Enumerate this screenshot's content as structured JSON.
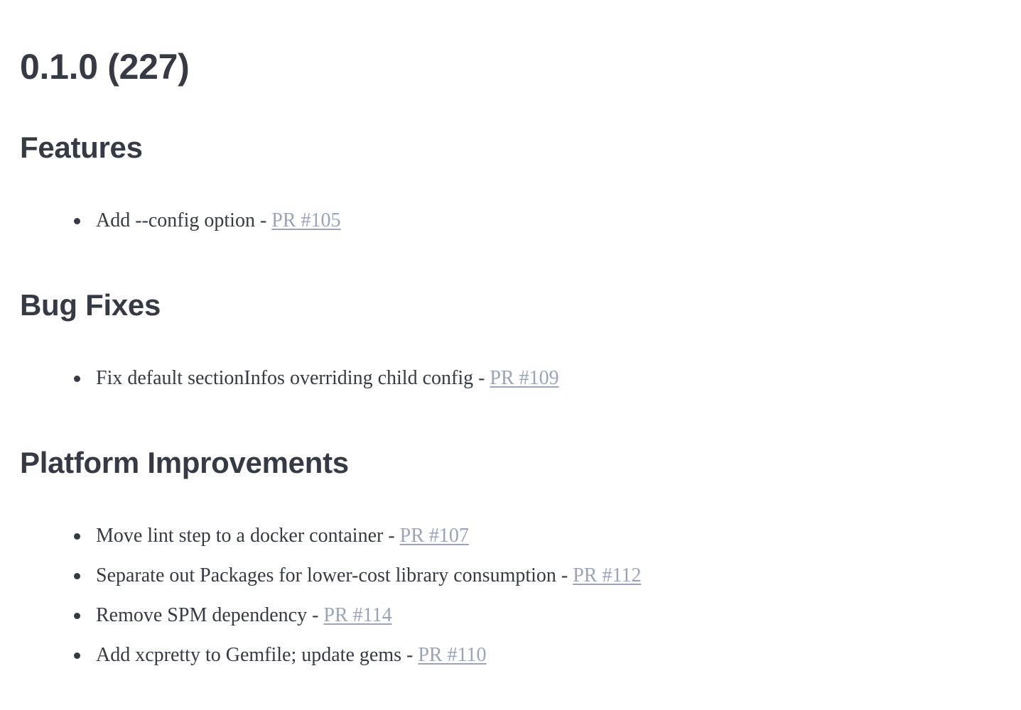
{
  "release": {
    "title": "0.1.0 (227)"
  },
  "sections": {
    "features": {
      "heading": "Features",
      "items": [
        {
          "text": "Add --config option - ",
          "link": "PR #105"
        }
      ]
    },
    "bugfixes": {
      "heading": "Bug Fixes",
      "items": [
        {
          "text": "Fix default sectionInfos overriding child config - ",
          "link": "PR #109"
        }
      ]
    },
    "platform": {
      "heading": "Platform Improvements",
      "items": [
        {
          "text": "Move lint step to a docker container - ",
          "link": "PR #107"
        },
        {
          "text": "Separate out Packages for lower-cost library consumption - ",
          "link": "PR #112"
        },
        {
          "text": "Remove SPM dependency - ",
          "link": "PR #114"
        },
        {
          "text": "Add xcpretty to Gemfile; update gems - ",
          "link": "PR #110"
        }
      ]
    }
  },
  "colors": {
    "text": "#363a45",
    "link": "#9aa3b8",
    "background": "#ffffff"
  }
}
